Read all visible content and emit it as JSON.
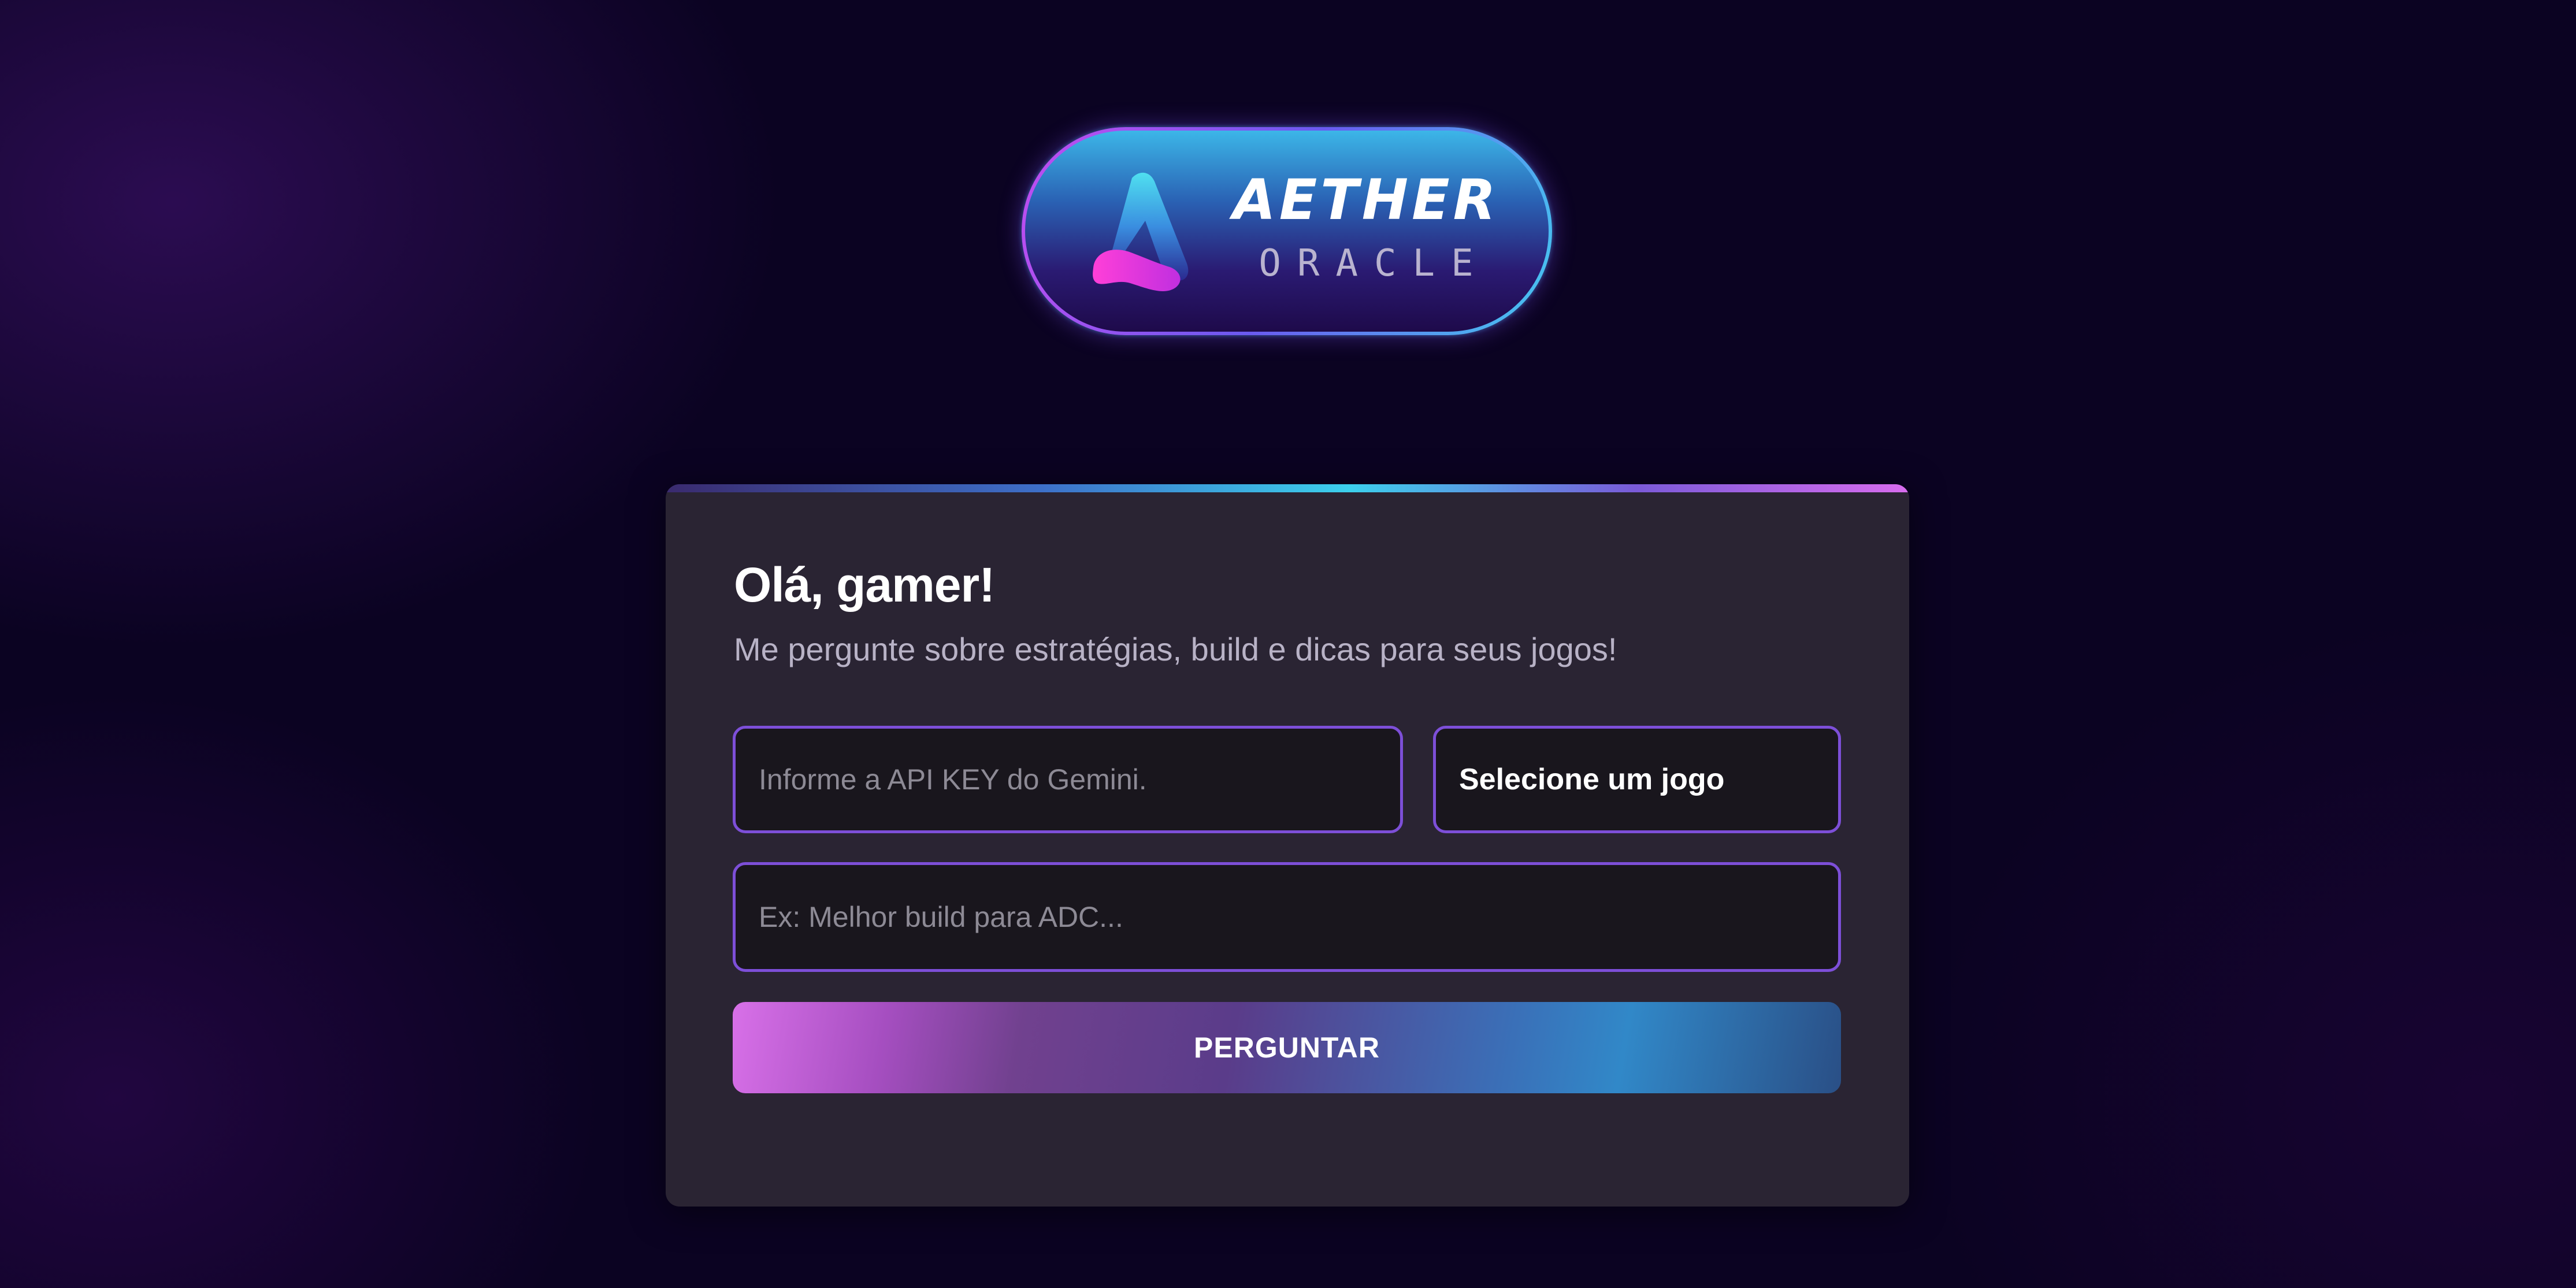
{
  "logo": {
    "title": "AETHER",
    "subtitle": "ORACLE",
    "icon": "aether-a-icon"
  },
  "card": {
    "greeting": "Olá, gamer!",
    "subtitle": "Me pergunte sobre estratégias, build e dicas para seus jogos!",
    "api_key": {
      "value": "",
      "placeholder": "Informe a API KEY do Gemini."
    },
    "game_select": {
      "selected": "Selecione um jogo"
    },
    "question": {
      "value": "",
      "placeholder": "Ex: Melhor build para ADC..."
    },
    "ask_button_label": "PERGUNTAR"
  },
  "colors": {
    "background": "#0b0322",
    "card": "#2a2433",
    "field_border": "#7d4fd8",
    "field_bg": "#19161d",
    "accent_cyan": "#3cd0ec",
    "accent_magenta": "#d870e8"
  }
}
